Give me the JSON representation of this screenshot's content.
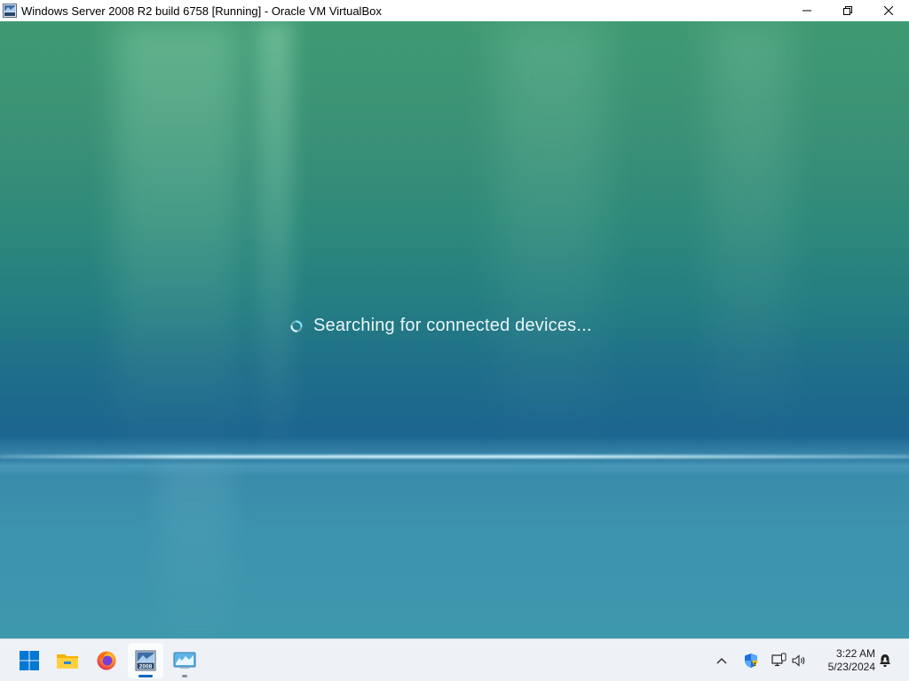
{
  "window": {
    "title": "Windows Server 2008 R2 build 6758 [Running] - Oracle VM VirtualBox",
    "app_icon": "virtualbox-vm-icon",
    "controls": [
      "minimize-icon",
      "restore-icon",
      "close-icon"
    ]
  },
  "guest": {
    "status_text": "Searching for connected devices...",
    "status_icon": "loading-spinner-icon"
  },
  "taskbar": {
    "items": [
      {
        "name": "start-button",
        "icon": "windows-logo-icon",
        "active": false,
        "open": false
      },
      {
        "name": "file-explorer",
        "icon": "folder-icon",
        "active": false,
        "open": false
      },
      {
        "name": "firefox",
        "icon": "firefox-icon",
        "active": false,
        "open": false
      },
      {
        "name": "windows-server-2008-vm",
        "icon": "server-2008-icon",
        "label": "2008",
        "active": true,
        "open": true
      },
      {
        "name": "virtualbox-manager",
        "icon": "virtualbox-icon",
        "active": false,
        "open": true
      }
    ],
    "tray": {
      "icons": [
        "chevron-up-icon",
        "security-shield-icon",
        "network-icon",
        "volume-icon",
        "notification-bell-icon"
      ],
      "time": "3:22 AM",
      "date": "5/23/2024"
    }
  },
  "colors": {
    "taskbar_bg": "#eef1f5",
    "active_indicator": "#0067c0",
    "windows_blue": "#0078d4"
  }
}
